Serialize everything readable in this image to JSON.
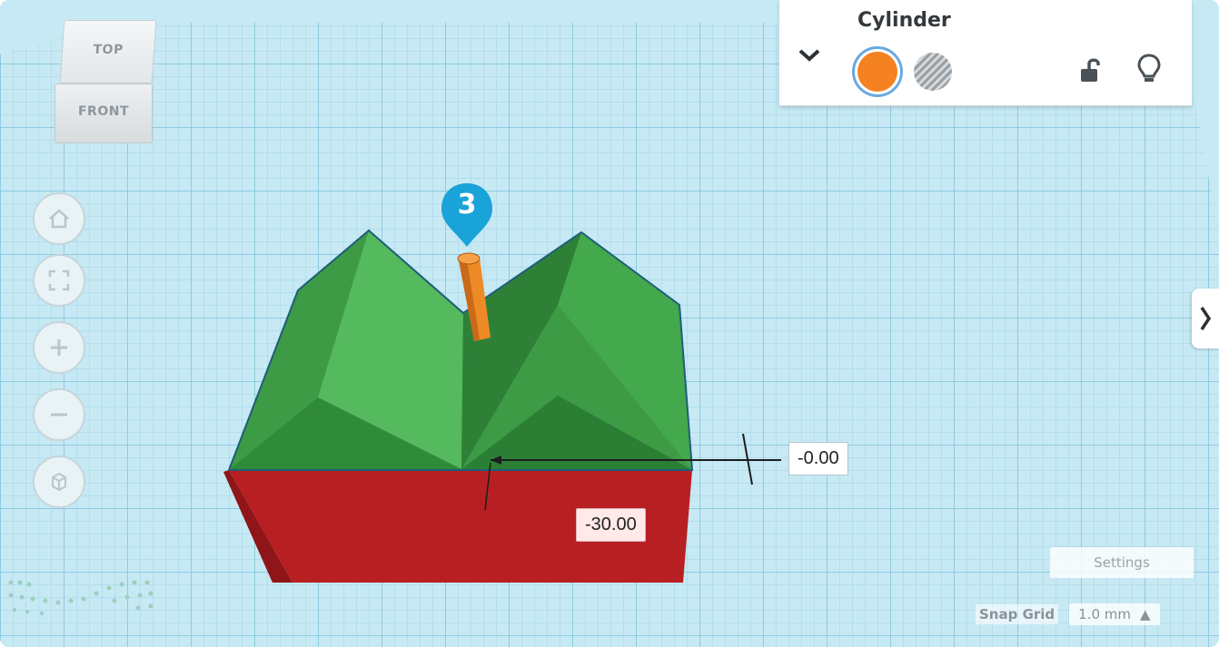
{
  "viewcube": {
    "top_label": "TOP",
    "front_label": "FRONT"
  },
  "nav_buttons": [
    {
      "name": "home-view-icon"
    },
    {
      "name": "fit-view-icon"
    },
    {
      "name": "zoom-in-icon"
    },
    {
      "name": "zoom-out-icon"
    },
    {
      "name": "perspective-icon"
    }
  ],
  "inspector": {
    "title": "Cylinder",
    "solid_color": "#f58220",
    "icons": [
      "chevron-down-icon",
      "lock-open-icon",
      "lightbulb-icon"
    ]
  },
  "dimensions": {
    "x_offset": "-0.00",
    "z_offset": "-30.00"
  },
  "callout": {
    "number": "3",
    "color": "#1aa3d9"
  },
  "settings": {
    "label": "Settings"
  },
  "snap_grid": {
    "label": "Snap Grid",
    "value": "1.0 mm"
  },
  "colors": {
    "grid_bg": "#bfe6f2",
    "grid_line": "#8fcbe0",
    "green_shape": "#3f9b47",
    "red_base": "#b81f22",
    "cylinder": "#f0902e"
  }
}
